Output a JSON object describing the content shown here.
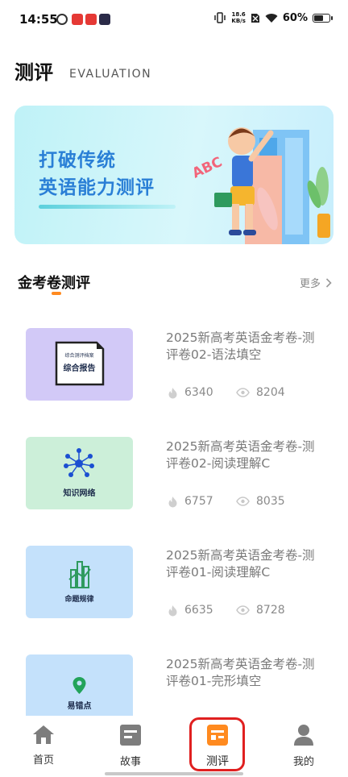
{
  "status_bar": {
    "time": "14:55",
    "net_speed_value": "18.6",
    "net_speed_unit": "KB/s",
    "battery_percent": "60%",
    "battery_level": 0.6
  },
  "header": {
    "title": "测评",
    "subtitle": "EVALUATION"
  },
  "banner": {
    "line1": "打破传统",
    "line2": "英语能力测评",
    "art_text": "ABC"
  },
  "section": {
    "title": "金考卷测评",
    "more_label": "更多"
  },
  "items": [
    {
      "thumb_label": "综合报告",
      "thumb_small": "综合测评档案",
      "title": "2025新高考英语金考卷-测评卷02-语法填空",
      "hot": "6340",
      "views": "8204"
    },
    {
      "thumb_label": "知识网络",
      "title": "2025新高考英语金考卷-测评卷02-阅读理解C",
      "hot": "6757",
      "views": "8035"
    },
    {
      "thumb_label": "命题规律",
      "title": "2025新高考英语金考卷-测评卷01-阅读理解C",
      "hot": "6635",
      "views": "8728"
    },
    {
      "thumb_label": "易错点",
      "title": "2025新高考英语金考卷-测评卷01-完形填空",
      "hot": "",
      "views": ""
    }
  ],
  "nav": {
    "home": "首页",
    "story": "故事",
    "evaluation": "测评",
    "mine": "我的"
  },
  "colors": {
    "accent": "#ff8a1f",
    "highlight_box": "#e02020",
    "banner_text": "#2a7fd6"
  }
}
